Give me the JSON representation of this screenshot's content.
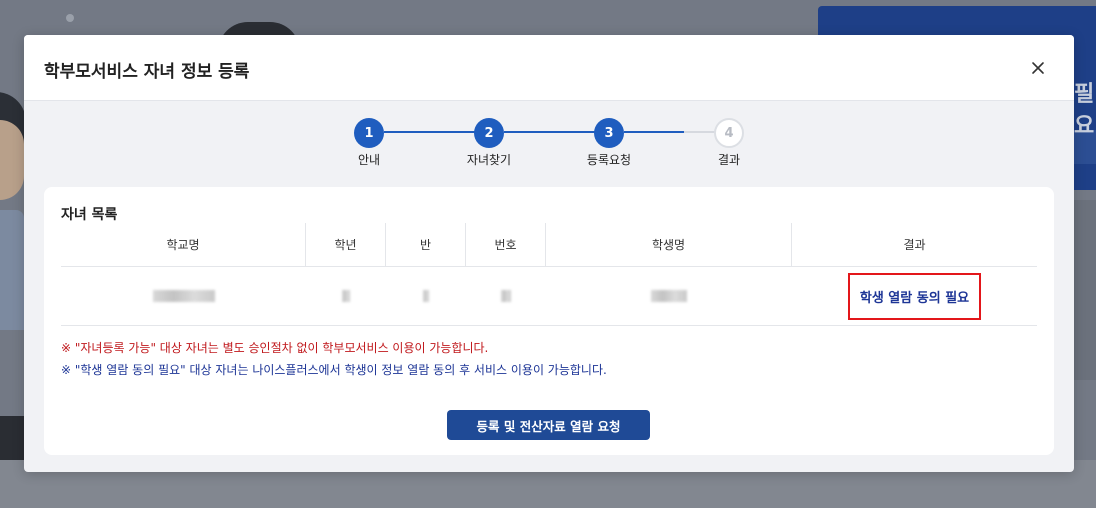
{
  "background": {
    "side_text": "필요"
  },
  "modal": {
    "title": "학부모서비스 자녀 정보 등록",
    "close_label": "×"
  },
  "stepper": {
    "steps": [
      {
        "number": "1",
        "label": "안내",
        "state": "done"
      },
      {
        "number": "2",
        "label": "자녀찾기",
        "state": "done"
      },
      {
        "number": "3",
        "label": "등록요청",
        "state": "current"
      },
      {
        "number": "4",
        "label": "결과",
        "state": "inactive"
      }
    ]
  },
  "children": {
    "section_title": "자녀 목록",
    "columns": [
      "학교명",
      "학년",
      "반",
      "번호",
      "학생명",
      "결과"
    ],
    "rows": [
      {
        "school": "",
        "grade": "",
        "class": "",
        "number": "",
        "student_name": "",
        "result": "학생 열람 동의 필요"
      }
    ]
  },
  "notes": {
    "red": "※ \"자녀등록 가능\" 대상 자녀는 별도 승인절차 없이 학부모서비스 이용이 가능합니다.",
    "blue": "※ \"학생 열람 동의 필요\" 대상 자녀는 나이스플러스에서 학생이 정보 열람 동의 후 서비스 이용이 가능합니다."
  },
  "actions": {
    "submit_label": "등록 및 전산자료 열람 요청"
  },
  "colors": {
    "primary": "#1f5dbf",
    "button": "#1f4a96",
    "note_red": "#c0181c",
    "note_blue": "#1d3596",
    "highlight_border": "#e3161a"
  }
}
